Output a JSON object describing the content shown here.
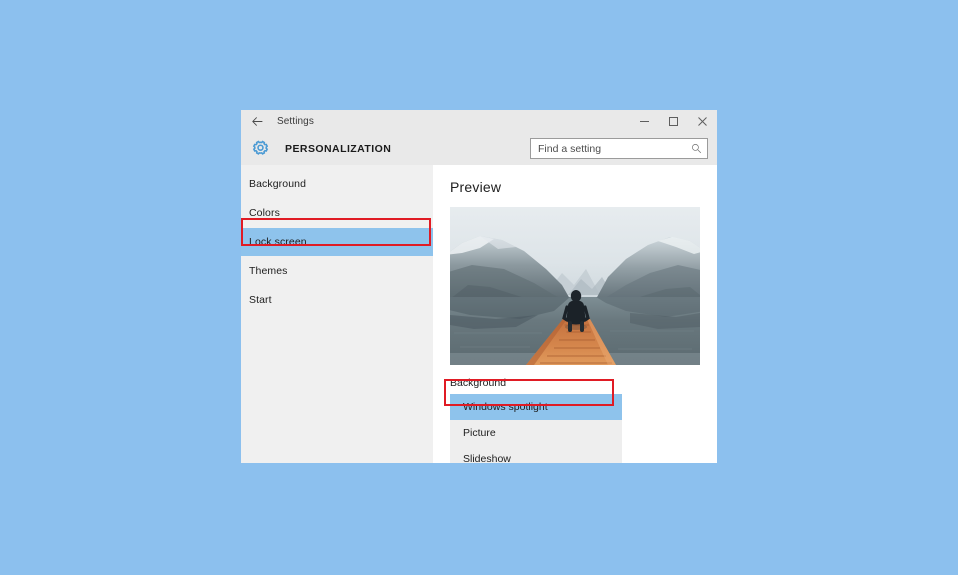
{
  "window": {
    "titlebar": {
      "back_label": "←",
      "title": "Settings",
      "minimize_label": "minimize-icon",
      "maximize_label": "maximize-icon",
      "close_label": "close-icon"
    },
    "header": {
      "icon": "gear-icon",
      "title": "PERSONALIZATION",
      "accent_color": "#4a9ad4"
    },
    "search": {
      "placeholder": "Find a setting",
      "value": "",
      "icon": "search-icon"
    }
  },
  "sidebar": {
    "items": [
      {
        "label": "Background",
        "selected": false
      },
      {
        "label": "Colors",
        "selected": false
      },
      {
        "label": "Lock screen",
        "selected": true
      },
      {
        "label": "Themes",
        "selected": false
      },
      {
        "label": "Start",
        "selected": false
      }
    ],
    "selected_color": "#8ec3ec"
  },
  "main": {
    "preview_heading": "Preview",
    "preview_image_alt": "lake-dock-preview",
    "background_label": "Background",
    "background_options": [
      {
        "label": "Windows spotlight",
        "selected": true
      },
      {
        "label": "Picture",
        "selected": false
      },
      {
        "label": "Slideshow",
        "selected": false
      }
    ],
    "selected_option": "Windows spotlight"
  },
  "annotations": [
    {
      "name": "lock-screen-highlight",
      "color": "#e01b24",
      "target": "Lock screen"
    },
    {
      "name": "windows-spotlight-highlight",
      "color": "#e01b24",
      "target": "Windows spotlight"
    }
  ],
  "desktop": {
    "background_color": "#8cc0ee"
  }
}
